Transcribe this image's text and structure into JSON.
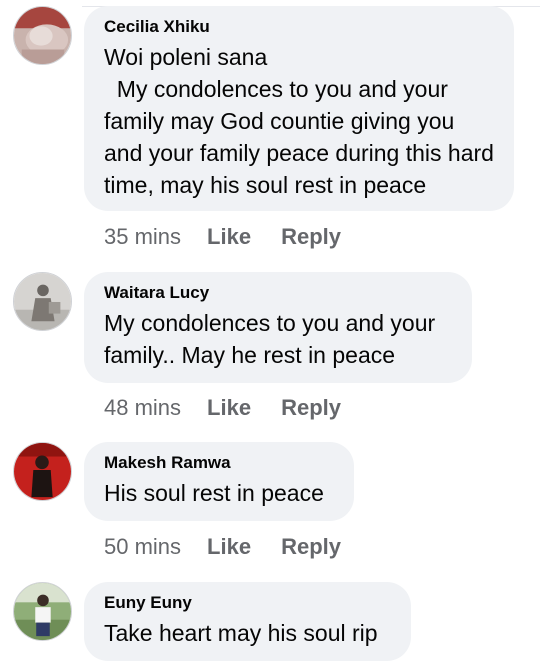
{
  "comments": [
    {
      "author": "Cecilia Xhiku",
      "text": "Woi poleni sana\n  My condolences to you and your family may God countie giving you and your family peace during this hard time, may his soul rest in peace",
      "time": "35 mins",
      "like_label": "Like",
      "reply_label": "Reply"
    },
    {
      "author": "Waitara Lucy",
      "text": "My condolences to you and your family.. May he rest in peace",
      "time": "48 mins",
      "like_label": "Like",
      "reply_label": "Reply"
    },
    {
      "author": "Makesh Ramwa",
      "text": "His soul rest in peace",
      "time": "50 mins",
      "like_label": "Like",
      "reply_label": "Reply"
    },
    {
      "author": "Euny Euny",
      "text": "Take heart may his soul rip"
    }
  ],
  "colors": {
    "bubble": "#f0f2f5",
    "text": "#050505",
    "meta": "#65676b"
  }
}
